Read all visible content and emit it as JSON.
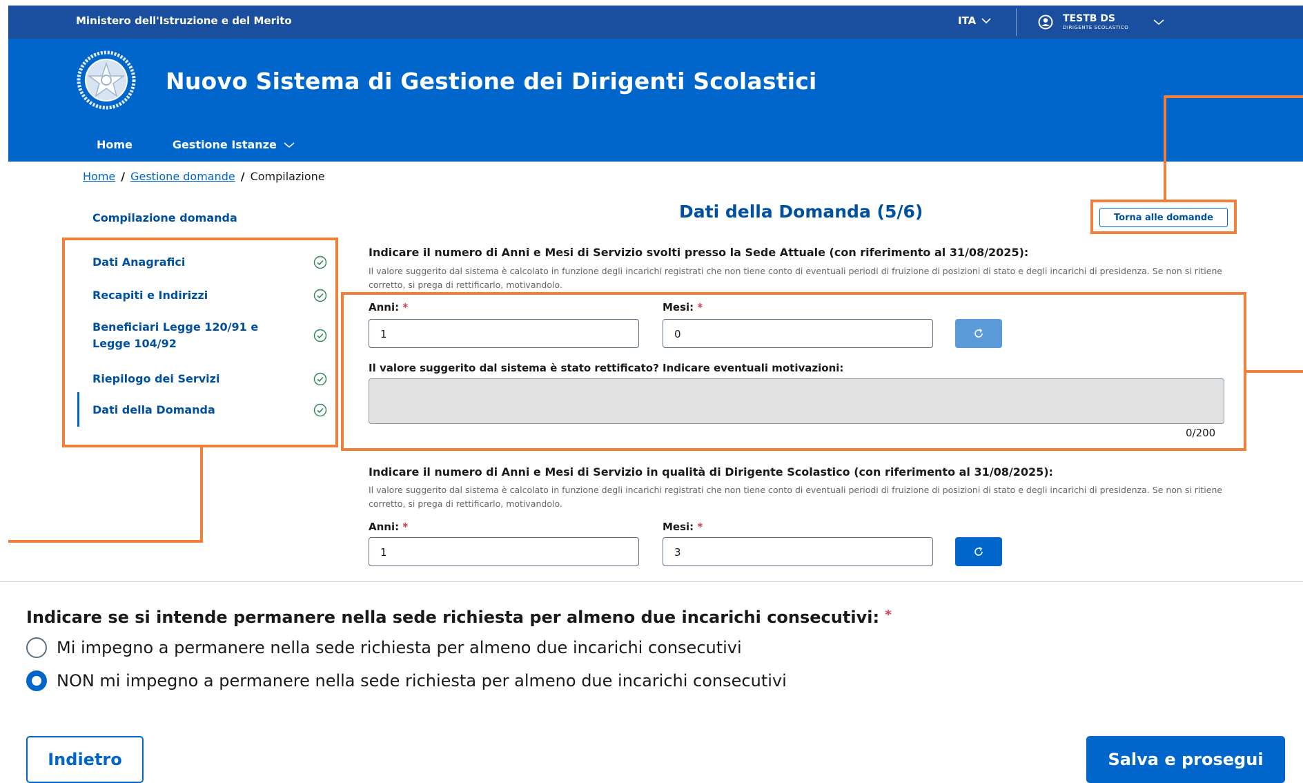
{
  "colors": {
    "header_top": "#1a4fa0",
    "header_main": "#0066cc",
    "accent": "#0066cc",
    "annotation": "#f07f3c",
    "check": "#2e8b57"
  },
  "topbar": {
    "ministry": "Ministero dell'Istruzione e del Merito",
    "language": "ITA",
    "user_name": "TESTB DS",
    "user_role": "DIRIGENTE SCOLASTICO"
  },
  "header": {
    "title": "Nuovo Sistema di Gestione dei Dirigenti Scolastici",
    "nav": [
      {
        "label": "Home"
      },
      {
        "label": "Gestione Istanze"
      }
    ]
  },
  "breadcrumb": {
    "items": [
      "Home",
      "Gestione domande",
      "Compilazione"
    ],
    "separator": "/"
  },
  "sidebar": {
    "heading": "Compilazione domanda",
    "items": [
      {
        "label": "Dati Anagrafici",
        "icon": "check-circle-icon"
      },
      {
        "label": "Recapiti e Indirizzi",
        "icon": "check-circle-icon"
      },
      {
        "label": "Beneficiari Legge 120/91 e Legge 104/92",
        "icon": "check-circle-icon"
      },
      {
        "label": "Riepilogo dei Servizi",
        "icon": "check-circle-icon"
      },
      {
        "label": "Dati della Domanda",
        "icon": "check-circle-icon",
        "active": true
      }
    ]
  },
  "main": {
    "section_title": "Dati della Domanda (5/6)",
    "back_to_list": "Torna alle domande",
    "block1": {
      "question": "Indicare il numero di Anni e Mesi di Servizio svolti presso la Sede Attuale (con riferimento al 31/08/2025):",
      "hint": "Il valore suggerito dal sistema è calcolato in funzione degli incarichi registrati che non tiene conto di eventuali periodi di fruizione di posizioni di stato e degli incarichi di presidenza. Se non si ritiene corretto, si prega di rettificarlo, motivandolo.",
      "years_label": "Anni:",
      "months_label": "Mesi:",
      "required_mark": "*",
      "years_value": "1",
      "months_value": "0",
      "motivation_label": "Il valore suggerito dal sistema è stato rettificato? Indicare eventuali motivazioni:",
      "motivation_value": "",
      "counter": "0/200"
    },
    "block2": {
      "question": "Indicare il numero di Anni e Mesi di Servizio in qualità di Dirigente Scolastico (con riferimento al 31/08/2025):",
      "hint": "Il valore suggerito dal sistema è calcolato in funzione degli incarichi registrati che non tiene conto di eventuali periodi di fruizione di posizioni di stato e degli incarichi di presidenza. Se non si ritiene corretto, si prega di rettificarlo, motivandolo.",
      "years_label": "Anni:",
      "months_label": "Mesi:",
      "required_mark": "*",
      "years_value": "1",
      "months_value": "3"
    },
    "permanence": {
      "question": "Indicare se si intende permanere nella sede richiesta per almeno due incarichi consecutivi:",
      "required_mark": "*",
      "options": [
        {
          "label": "Mi impegno a permanere nella sede richiesta per almeno due incarichi consecutivi",
          "selected": false
        },
        {
          "label": "NON mi impegno a permanere nella sede richiesta per almeno due incarichi consecutivi",
          "selected": true
        }
      ]
    }
  },
  "footer": {
    "back_label": "Indietro",
    "save_label": "Salva e prosegui"
  }
}
